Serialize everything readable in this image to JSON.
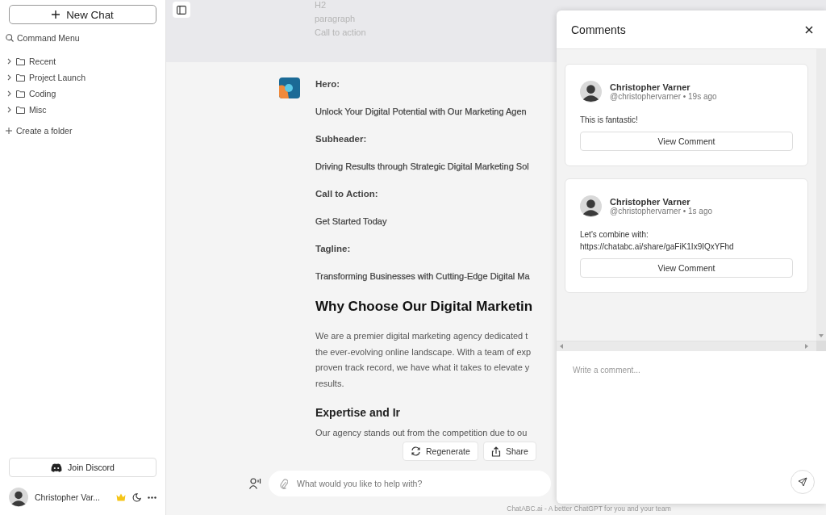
{
  "sidebar": {
    "new_chat": "New Chat",
    "command_menu": "Command Menu",
    "folders": [
      {
        "label": "Recent",
        "expanded": false
      },
      {
        "label": "Project Launch",
        "expanded": false
      },
      {
        "label": "Coding",
        "expanded": false
      },
      {
        "label": "Misc",
        "expanded": false
      }
    ],
    "create_folder": "Create a folder",
    "join_discord": "Join Discord",
    "user": {
      "name": "Christopher Var..."
    }
  },
  "user_message": {
    "lines": [
      "H2",
      "paragraph",
      "Call to action"
    ]
  },
  "assistant_message": {
    "blocks": [
      {
        "kind": "label",
        "text": "Hero:"
      },
      {
        "kind": "text",
        "text": "Unlock Your Digital Potential with Our Marketing Agen"
      },
      {
        "kind": "label",
        "text": "Subheader:"
      },
      {
        "kind": "text",
        "text": "Driving Results through Strategic Digital Marketing Sol"
      },
      {
        "kind": "label",
        "text": "Call to Action:"
      },
      {
        "kind": "text",
        "text": "Get Started Today"
      },
      {
        "kind": "label",
        "text": "Tagline:"
      },
      {
        "kind": "text",
        "text": "Transforming Businesses with Cutting-Edge Digital Ma"
      },
      {
        "kind": "heading",
        "text": "Why Choose Our Digital Marketin"
      },
      {
        "kind": "paragraph",
        "lines": [
          "We are a premier digital marketing agency dedicated t",
          "the ever-evolving online landscape. With a team of exp",
          "proven track record, we have what it takes to elevate y",
          "results."
        ]
      },
      {
        "kind": "subheading",
        "text": "Expertise and Ir"
      },
      {
        "kind": "paragraph",
        "lines": [
          "Our agency stands out from the competition due to ou"
        ]
      }
    ]
  },
  "actions": [
    {
      "kind": "regenerate",
      "label": "Regenerate"
    },
    {
      "kind": "share",
      "label": "Share"
    }
  ],
  "composer": {
    "placeholder": "What would you like to help with?"
  },
  "footer": "ChatABC.ai - A better ChatGPT for you and your team",
  "comments_panel": {
    "title": "Comments",
    "comments": [
      {
        "name": "Christopher Varner",
        "meta": "@christophervarner • 19s ago",
        "lines": [
          "This is fantastic!"
        ],
        "button": "View Comment"
      },
      {
        "name": "Christopher Varner",
        "meta": "@christophervarner • 1s ago",
        "lines": [
          "Let's combine with:",
          "https://chatabc.ai/share/gaFiK1Ix9IQxYFhd"
        ],
        "button": "View Comment"
      }
    ],
    "composer": {
      "placeholder": "Write a comment..."
    }
  }
}
